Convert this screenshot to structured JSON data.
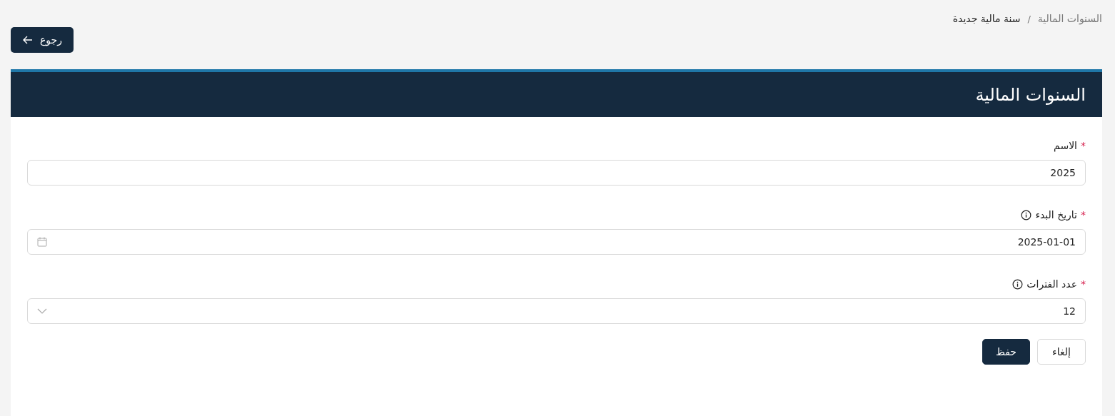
{
  "breadcrumb": [
    {
      "label": "السنوات المالية",
      "current": false
    },
    {
      "label": "سنة مالية جديدة",
      "current": true
    }
  ],
  "breadcrumb_separator": "/",
  "back_button": {
    "label": "رجوع"
  },
  "card": {
    "title": "السنوات المالية"
  },
  "fields": [
    {
      "kind": "text",
      "label": "الاسم",
      "required_mark": "*",
      "info": false,
      "value": "2025"
    },
    {
      "kind": "date",
      "label": "تاريخ البدء",
      "required_mark": "*",
      "info": true,
      "value": "2025-01-01"
    },
    {
      "kind": "select",
      "label": "عدد الفترات",
      "required_mark": "*",
      "info": true,
      "value": "12"
    }
  ],
  "actions": [
    {
      "kind": "secondary",
      "label": "إلغاء"
    },
    {
      "kind": "primary",
      "label": "حفظ"
    }
  ]
}
